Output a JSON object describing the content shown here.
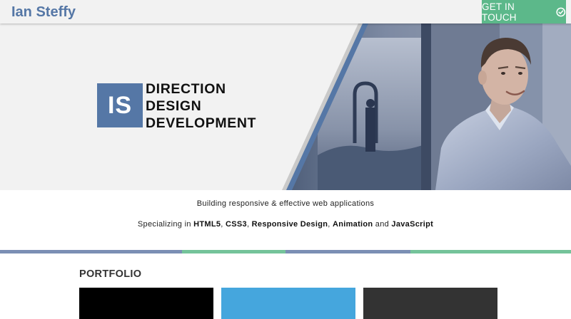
{
  "header": {
    "brand": "Ian Steffy",
    "cta_label": "GET IN TOUCH",
    "cta_icon": "check-circle-icon"
  },
  "hero": {
    "logo_text": "IS",
    "tagline": [
      "DIRECTION",
      "DESIGN",
      "DEVELOPMENT"
    ]
  },
  "intro": {
    "line1": "Building responsive & effective web applications",
    "line2_prefix": "Specializing in ",
    "skills": [
      "HTML5",
      "CSS3",
      "Responsive Design",
      "Animation",
      "JavaScript"
    ],
    "sep_comma": ", ",
    "sep_and": " and "
  },
  "portfolio": {
    "title": "PORTFOLIO",
    "tiles": [
      {
        "color": "#000000"
      },
      {
        "color": "#45a6dd"
      },
      {
        "color": "#333333"
      }
    ]
  },
  "colors": {
    "accent_blue": "#5577a6",
    "accent_green": "#5cb88a",
    "stripe_blue": "#7b8fb4",
    "stripe_green": "#74c39a"
  }
}
